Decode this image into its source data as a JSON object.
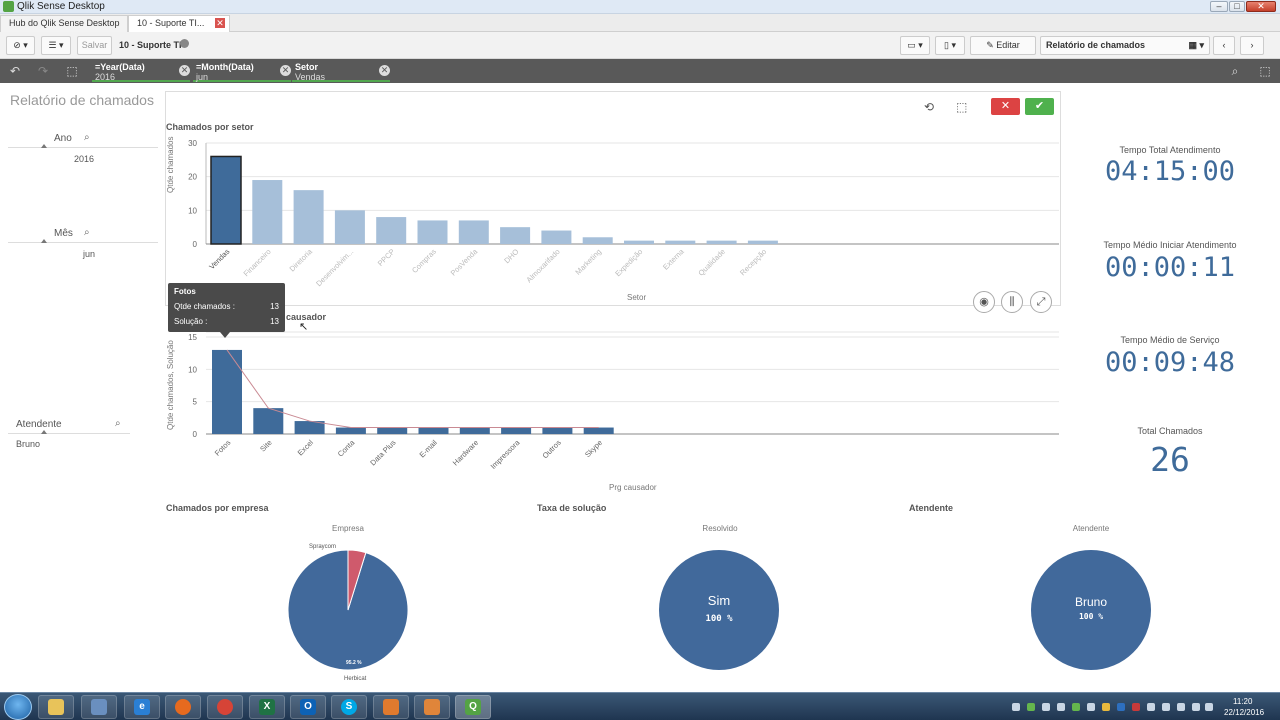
{
  "window": {
    "title": "Qlik Sense Desktop",
    "controls": [
      "–",
      "□",
      "✕"
    ]
  },
  "tabs": [
    {
      "label": "Hub do Qlik Sense Desktop"
    },
    {
      "label": "10 - Suporte TI..."
    }
  ],
  "toolbar": {
    "save_label": "Salvar",
    "app_name": "10 - Suporte TI",
    "edit_label": "Editar",
    "sheet_selector": "Relatório de chamados"
  },
  "selections": [
    {
      "field": "=Year(Data)",
      "value": "2016"
    },
    {
      "field": "=Month(Data)",
      "value": "jun"
    },
    {
      "field": "Setor",
      "value": "Vendas"
    }
  ],
  "sheet_title": "Relatório de chamados",
  "filters": {
    "ano": {
      "label": "Ano",
      "value": "2016"
    },
    "mes": {
      "label": "Mês",
      "value": "jun"
    },
    "atendente": {
      "label": "Atendente",
      "value": "Bruno"
    }
  },
  "bar_chart": {
    "title": "Chamados por setor",
    "ylabel": "Qtde chamados",
    "xlabel": "Setor"
  },
  "pareto_chart": {
    "title_suffix": "causador",
    "ylabel": "Qtde chamados, Solução",
    "xlabel": "Prg causador"
  },
  "tooltip": {
    "title": "Fotos",
    "rows": [
      {
        "label": "Qtde chamados :",
        "value": "13"
      },
      {
        "label": "Solução :",
        "value": "13"
      }
    ]
  },
  "kpis": [
    {
      "label": "Tempo Total Atendimento",
      "value": "04:15:00"
    },
    {
      "label": "Tempo Médio Iniciar Atendimento",
      "value": "00:00:11"
    },
    {
      "label": "Tempo Médio de Serviço",
      "value": "00:09:48"
    },
    {
      "label": "Total Chamados",
      "value": "26"
    }
  ],
  "pies": [
    {
      "title": "Chamados por empresa",
      "dimension": "Empresa",
      "slice_small_label": "Spraycom",
      "slice_big_label": "Herbicat",
      "big_pct": "95.2 %"
    },
    {
      "title": "Taxa de solução",
      "dimension": "Resolvido",
      "center_label": "Sim",
      "center_pct": "100 %"
    },
    {
      "title": "Atendente",
      "dimension": "Atendente",
      "center_label": "Bruno",
      "center_pct": "100 %"
    }
  ],
  "taskbar": {
    "time": "11:20",
    "date": "22/12/2016"
  },
  "colors": {
    "selected_bar": "#3f6b9a",
    "dimmed_bar": "#a6bfd9",
    "pie_main": "#41699b",
    "pie_accent": "#cf5a6c",
    "kpi": "#3f6b9a"
  },
  "chart_data": [
    {
      "type": "bar",
      "title": "Chamados por setor",
      "xlabel": "Setor",
      "ylabel": "Qtde chamados",
      "categories": [
        "Vendas",
        "Financeiro",
        "Diretoria",
        "Desenvolvim...",
        "PPCP",
        "Compras",
        "PosVenda",
        "DHO",
        "Almoxarifado",
        "Marketing",
        "Expedição",
        "Externa",
        "Qualidade",
        "Recepção"
      ],
      "values": [
        26,
        19,
        16,
        10,
        8,
        7,
        7,
        5,
        4,
        2,
        1,
        1,
        1,
        1
      ],
      "yticks": [
        0,
        10,
        20,
        30
      ],
      "ylim": [
        0,
        30
      ],
      "selected": "Vendas"
    },
    {
      "type": "bar",
      "title": "causador",
      "xlabel": "Prg causador",
      "ylabel": "Qtde chamados, Solução",
      "categories": [
        "Fotos",
        "Site",
        "Excel",
        "Conta",
        "Data Plus",
        "E-mail",
        "Hardware",
        "Impressora",
        "Outros",
        "Skype"
      ],
      "values": [
        13,
        4,
        2,
        1,
        1,
        1,
        1,
        1,
        1,
        1
      ],
      "line": [
        13,
        4,
        2,
        1,
        1,
        1,
        1,
        1,
        1,
        1
      ],
      "yticks": [
        0,
        5,
        10,
        15
      ],
      "ylim": [
        0,
        15
      ]
    },
    {
      "type": "pie",
      "title": "Chamados por empresa",
      "categories": [
        "Herbicat",
        "Spraycom"
      ],
      "values": [
        95.2,
        4.8
      ]
    },
    {
      "type": "pie",
      "title": "Taxa de solução",
      "categories": [
        "Sim"
      ],
      "values": [
        100
      ]
    },
    {
      "type": "pie",
      "title": "Atendente",
      "categories": [
        "Bruno"
      ],
      "values": [
        100
      ]
    }
  ]
}
